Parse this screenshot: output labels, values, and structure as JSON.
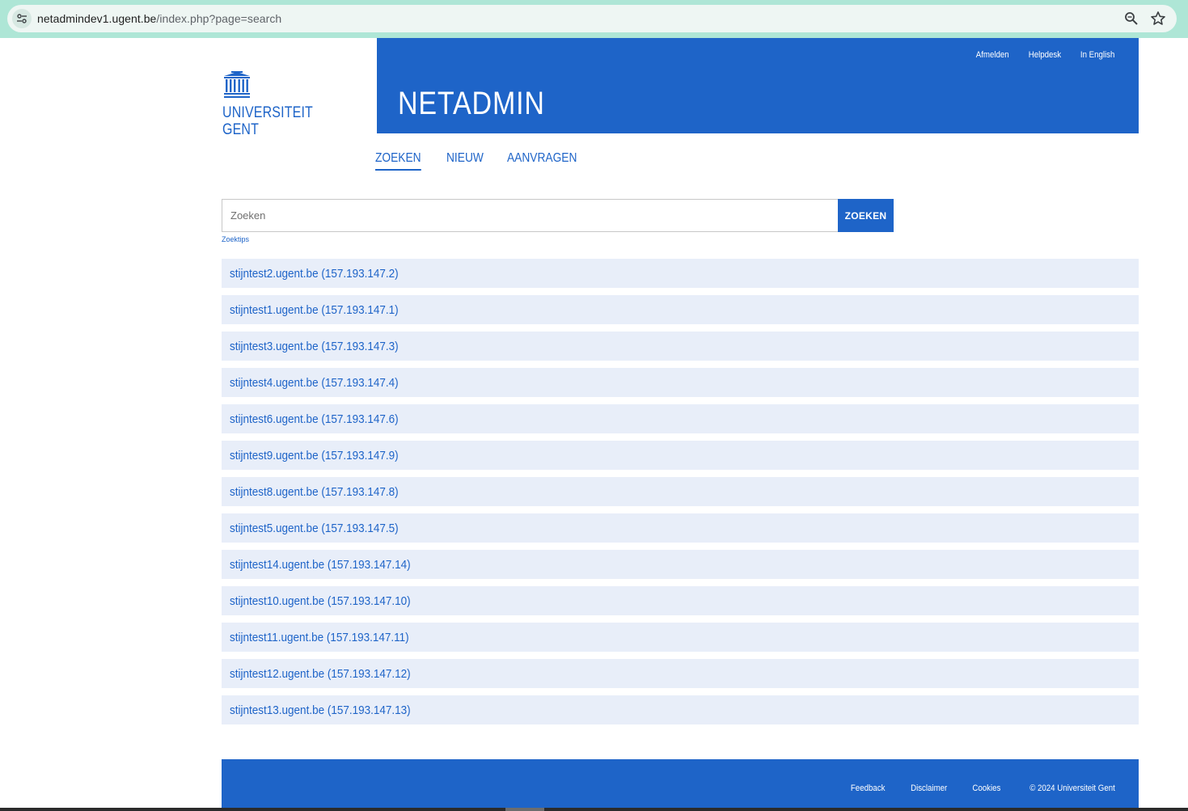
{
  "browser": {
    "url_host": "netadmindev1.ugent.be",
    "url_path": "/index.php?page=search"
  },
  "logo": {
    "line1": "UNIVERSITEIT",
    "line2": "GENT"
  },
  "banner": {
    "title": "NETADMIN",
    "links": [
      "Afmelden",
      "Helpdesk",
      "In English"
    ]
  },
  "nav": {
    "items": [
      "ZOEKEN",
      "NIEUW",
      "AANVRAGEN"
    ],
    "active": "ZOEKEN"
  },
  "search": {
    "placeholder": "Zoeken",
    "button_label": "ZOEKEN",
    "tips_label": "Zoektips"
  },
  "results": [
    "stijntest2.ugent.be (157.193.147.2)",
    "stijntest1.ugent.be (157.193.147.1)",
    "stijntest3.ugent.be (157.193.147.3)",
    "stijntest4.ugent.be (157.193.147.4)",
    "stijntest6.ugent.be (157.193.147.6)",
    "stijntest9.ugent.be (157.193.147.9)",
    "stijntest8.ugent.be (157.193.147.8)",
    "stijntest5.ugent.be (157.193.147.5)",
    "stijntest14.ugent.be (157.193.147.14)",
    "stijntest10.ugent.be (157.193.147.10)",
    "stijntest11.ugent.be (157.193.147.11)",
    "stijntest12.ugent.be (157.193.147.12)",
    "stijntest13.ugent.be (157.193.147.13)"
  ],
  "footer": {
    "links": [
      "Feedback",
      "Disclaimer",
      "Cookies",
      "© 2024 Universiteit Gent"
    ]
  },
  "colors": {
    "brand_blue": "#1e64c8",
    "row_background": "#e8eef9",
    "chrome_green": "#aee6d6"
  }
}
